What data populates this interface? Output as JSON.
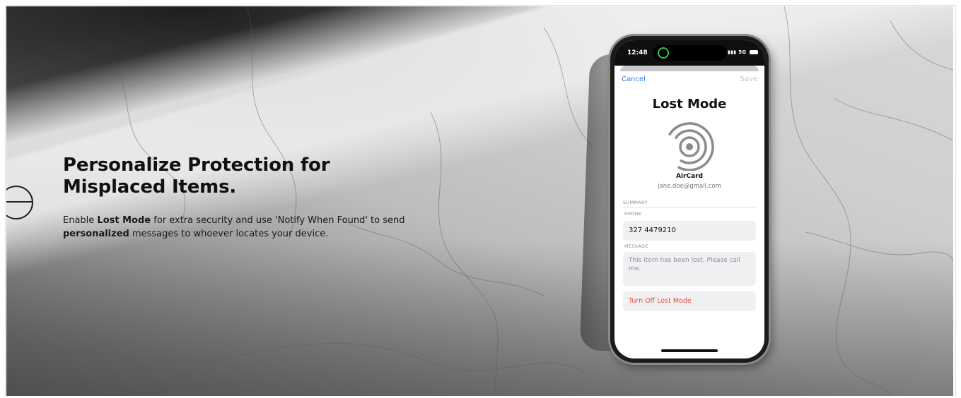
{
  "hero": {
    "headline": "Personalize Protection for Misplaced Items.",
    "description_prefix": "Enable ",
    "description_bold1": "Lost Mode",
    "description_middle": " for extra security and use 'Notify When Found' to send ",
    "description_bold2": "personalized",
    "description_suffix": " messages to whoever locates your device."
  },
  "phone": {
    "status": {
      "time": "12:48",
      "network": "5G"
    },
    "nav": {
      "cancel_label": "Cancel",
      "save_label": "Save"
    },
    "title": "Lost Mode",
    "item": {
      "name": "AirCard",
      "email": "jane.doe@gmail.com"
    },
    "summary_label": "SUMMARY",
    "phone_label": "PHONE",
    "phone_value": "327 4479210",
    "message_label": "MESSAGE",
    "message_value": "This item has been lost. Please call me.",
    "turn_off_label": "Turn Off Lost Mode"
  },
  "colors": {
    "ios_blue": "#2f7bf5",
    "destructive_red": "#e0533b",
    "findmy_green": "#33c24d"
  }
}
